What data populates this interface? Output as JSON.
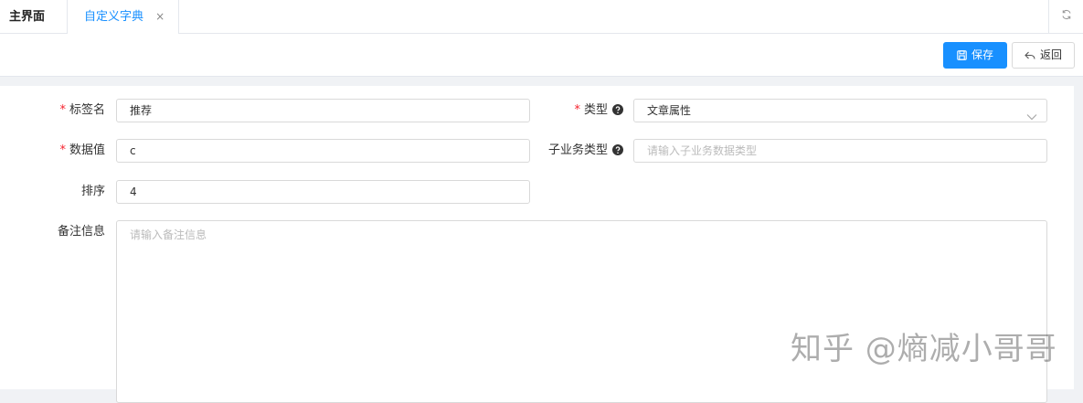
{
  "tabs": {
    "home_label": "主界面",
    "active_label": "自定义字典",
    "close_glyph": "×"
  },
  "toolbar": {
    "save_label": "保存",
    "back_label": "返回"
  },
  "form": {
    "tag_name": {
      "label": "标签名",
      "required": "*",
      "value": "推荐"
    },
    "type": {
      "label": "类型",
      "required": "*",
      "value": "文章属性"
    },
    "data_value": {
      "label": "数据值",
      "required": "*",
      "value": "c"
    },
    "sub_type": {
      "label": "子业务类型",
      "placeholder": "请输入子业务数据类型"
    },
    "sort": {
      "label": "排序",
      "value": "4"
    },
    "remark": {
      "label": "备注信息",
      "placeholder": "请输入备注信息"
    }
  },
  "watermark": "知乎 @熵减小哥哥",
  "colors": {
    "primary": "#1890ff",
    "required": "#f5222d"
  }
}
